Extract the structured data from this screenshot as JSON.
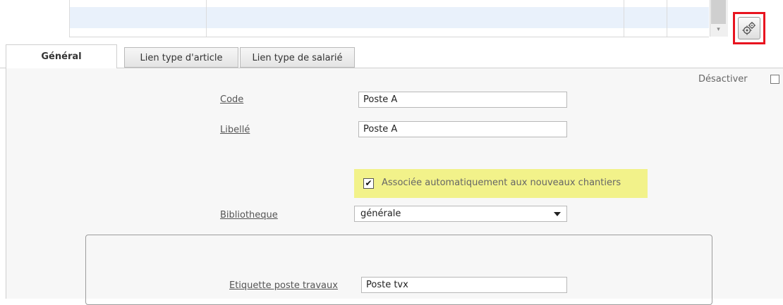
{
  "toolbar": {
    "settings_icon": "gears-icon"
  },
  "tabs": [
    {
      "label": "Général",
      "active": true
    },
    {
      "label": "Lien type d'article",
      "active": false
    },
    {
      "label": "Lien type de salarié",
      "active": false
    }
  ],
  "form": {
    "deactivate_label": "Désactiver",
    "deactivate_checked": false,
    "code_label": "Code",
    "code_value": "Poste A",
    "libelle_label": "Libellé",
    "libelle_value": "Poste A",
    "auto_assoc_label": "Associée automatiquement aux nouveaux chantiers",
    "auto_assoc_checked": true,
    "auto_assoc_mark": "✔",
    "bibliotheque_label": "Bibliotheque",
    "bibliotheque_value": "générale",
    "etiquette_label": "Etiquette poste travaux",
    "etiquette_value": "Poste tvx"
  },
  "colors": {
    "highlight": "#f2f28a",
    "red_frame": "#e8141f",
    "grid_row": "#e9f1fb"
  }
}
